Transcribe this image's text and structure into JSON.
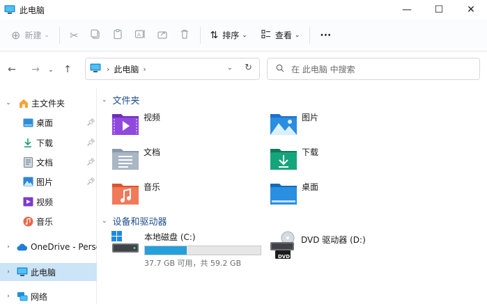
{
  "window": {
    "title": "此电脑",
    "minimize_icon": "minimize-icon",
    "maximize_icon": "maximize-icon",
    "close_icon": "close-icon"
  },
  "toolbar": {
    "new_label": "新建",
    "sort_label": "排序",
    "view_label": "查看",
    "more_label": "···"
  },
  "address": {
    "crumb": "此电脑"
  },
  "search": {
    "placeholder": "在 此电脑 中搜索"
  },
  "sidebar": {
    "home": "主文件夹",
    "items": [
      {
        "label": "桌面",
        "pinned": true
      },
      {
        "label": "下载",
        "pinned": true
      },
      {
        "label": "文档",
        "pinned": true
      },
      {
        "label": "图片",
        "pinned": true
      },
      {
        "label": "视频",
        "pinned": false
      },
      {
        "label": "音乐",
        "pinned": false
      }
    ],
    "onedrive": "OneDrive - Persor",
    "thispc": "此电脑",
    "network": "网络"
  },
  "content": {
    "folders_header": "文件夹",
    "folders": [
      "视频",
      "图片",
      "文档",
      "下载",
      "音乐",
      "桌面"
    ],
    "devices_header": "设备和驱动器",
    "drives": [
      {
        "name": "本地磁盘 (C:)",
        "free_text": "37.7 GB 可用，共 59.2 GB",
        "used_fraction": 0.363
      },
      {
        "name": "DVD 驱动器 (D:)",
        "badge": "DVD"
      }
    ]
  },
  "colors": {
    "accent": "#26a0da",
    "selected": "#cce4f7",
    "section_header": "#1f4e8c"
  }
}
